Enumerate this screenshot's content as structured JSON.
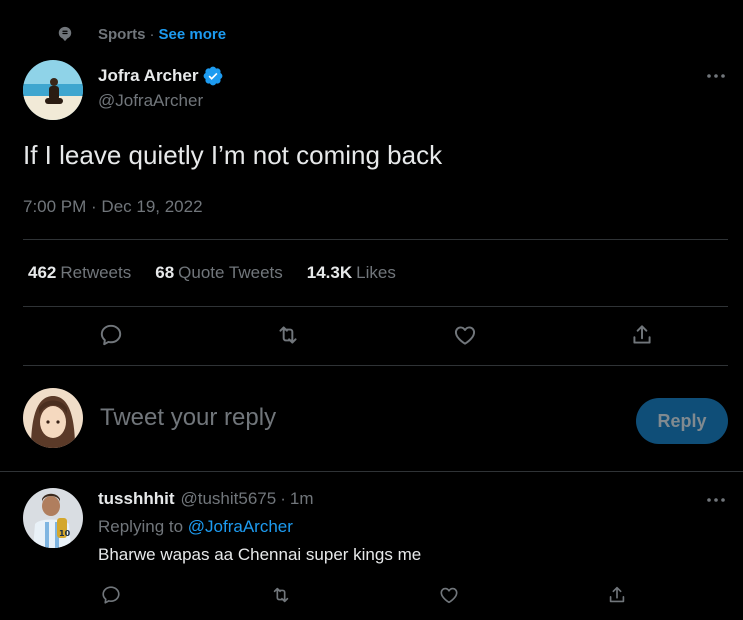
{
  "topic": {
    "label": "Sports",
    "separator": "·",
    "link": "See more"
  },
  "tweet": {
    "author_name": "Jofra Archer",
    "author_handle": "@JofraArcher",
    "text": "If I leave quietly I’m not coming back",
    "timestamp": "7:00 PM · Dec 19, 2022",
    "stats": [
      {
        "number": "462",
        "label": "Retweets"
      },
      {
        "number": "68",
        "label": "Quote Tweets"
      },
      {
        "number": "14.3K",
        "label": "Likes"
      }
    ]
  },
  "reply_box": {
    "placeholder": "Tweet your reply",
    "button": "Reply"
  },
  "comment": {
    "name": "tusshhhit",
    "handle": "@tushit5675",
    "separator": "·",
    "time": "1m",
    "replying_to_prefix": "Replying to",
    "replying_to_handle": "@JofraArcher",
    "text": "Bharwe wapas aa Chennai super kings me"
  },
  "colors": {
    "background": "#000000",
    "text": "#e7e9ea",
    "secondary": "#71767b",
    "accent": "#1d9bf0",
    "divider": "#2f3336",
    "reply_button": "#0f4e78"
  },
  "icons": [
    "topic-icon",
    "verified-icon",
    "more-icon",
    "reply-icon",
    "retweet-icon",
    "like-icon",
    "share-icon"
  ]
}
